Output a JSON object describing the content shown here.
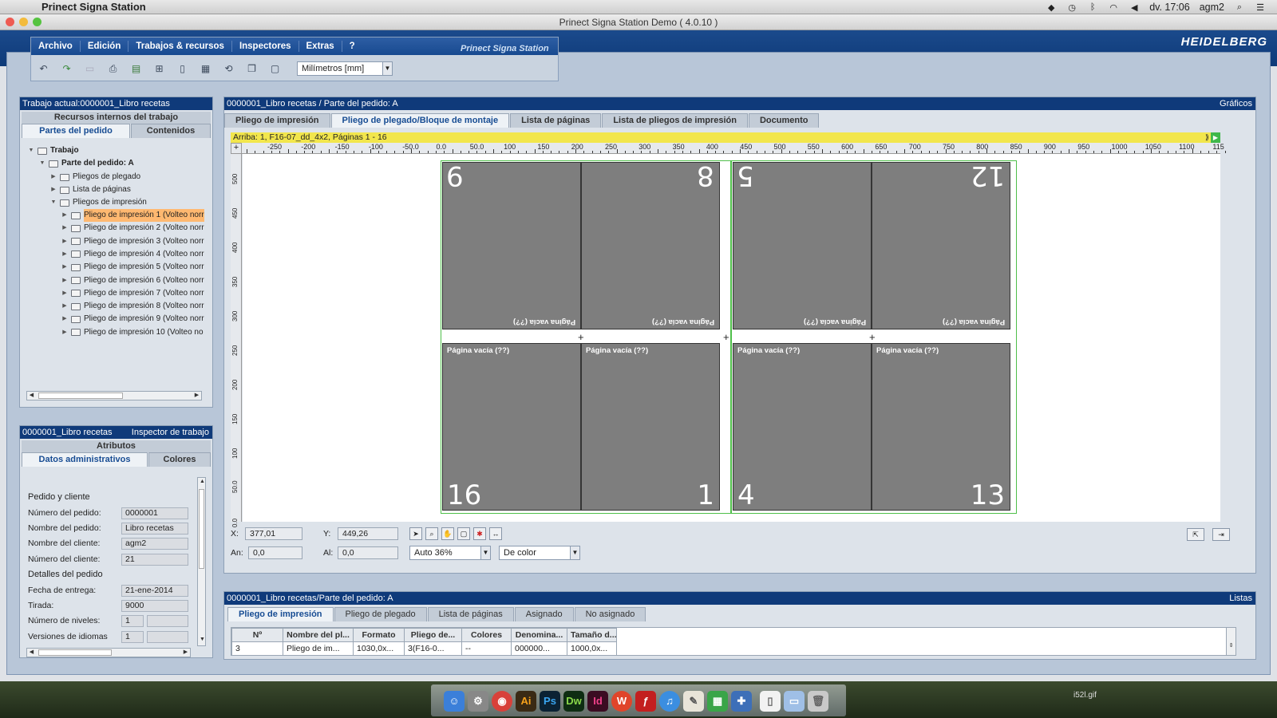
{
  "mac": {
    "app_name": "Prinect Signa Station",
    "day_time": "dv. 17:06",
    "user": "agm2",
    "icons": [
      "dropbox-icon",
      "time-machine-icon",
      "bluetooth-icon",
      "wifi-icon",
      "volume-icon",
      "spotlight-icon",
      "notification-center-icon"
    ]
  },
  "window": {
    "title": "Prinect Signa Station Demo ( 4.0.10 )",
    "brand": "HEIDELBERG",
    "signa_logo": "Prinect Signa Station"
  },
  "menu": {
    "items": [
      "Archivo",
      "Edición",
      "Trabajos & recursos",
      "Inspectores",
      "Extras",
      "?"
    ]
  },
  "toolbar": {
    "icons": [
      "undo-icon",
      "redo-icon",
      "cut-icon",
      "print-icon",
      "job-icon",
      "marks-icon",
      "page-icon",
      "sheet-icon",
      "rotate-icon",
      "copy-icon",
      "paste-icon"
    ],
    "units_value": "Milímetros  [mm]"
  },
  "left": {
    "title": "Trabajo actual:0000001_Libro recetas",
    "resources_header": "Recursos internos del trabajo",
    "tabs": [
      "Partes del pedido",
      "Contenidos"
    ],
    "tree": {
      "root": "Trabajo",
      "part": "Parte del pedido: A",
      "folding": "Pliegos de plegado",
      "pages": "Lista de páginas",
      "press": "Pliegos de impresión",
      "sheets": [
        "Pliego de impresión 1 (Volteo norr",
        "Pliego de impresión 2 (Volteo norr",
        "Pliego de impresión 3 (Volteo norr",
        "Pliego de impresión 4 (Volteo norr",
        "Pliego de impresión 5 (Volteo norr",
        "Pliego de impresión 6 (Volteo norr",
        "Pliego de impresión 7 (Volteo norr",
        "Pliego de impresión 8 (Volteo norr",
        "Pliego de impresión 9 (Volteo norr",
        "Pliego de impresión 10 (Volteo no"
      ]
    }
  },
  "inspector": {
    "title_left": "0000001_Libro recetas",
    "title_right": "Inspector de trabajo",
    "attributes": "Atributos",
    "tabs": [
      "Datos administrativos",
      "Colores"
    ],
    "section1": "Pedido y cliente",
    "section2": "Detalles del pedido",
    "fields": [
      {
        "label": "Número del pedido:",
        "value": "0000001"
      },
      {
        "label": "Nombre del pedido:",
        "value": "Libro recetas"
      },
      {
        "label": "Nombre del cliente:",
        "value": "agm2"
      },
      {
        "label": "Número del cliente:",
        "value": "21"
      },
      {
        "label": "Fecha de entrega:",
        "value": "21-ene-2014"
      },
      {
        "label": "Tirada:",
        "value": "9000"
      },
      {
        "label": "Número de niveles:",
        "value": "1"
      },
      {
        "label": "Versiones de idiomas",
        "value": "1"
      }
    ]
  },
  "center": {
    "title": "0000001_Libro recetas / Parte del pedido: A",
    "title_right": "Gráficos",
    "tabs": [
      "Pliego de impresión",
      "Pliego de plegado/Bloque de montaje",
      "Lista de páginas",
      "Lista de pliegos de impresión",
      "Documento"
    ],
    "active_tab": 1,
    "infobar": "Arriba:  1, F16-07_dd_4x2, Páginas 1 - 16",
    "ruler_top": [
      "-250",
      "-200",
      "-150",
      "-100",
      "-50.0",
      "0.0",
      "50.0",
      "100",
      "150",
      "200",
      "250",
      "300",
      "350",
      "400",
      "450",
      "500",
      "550",
      "600",
      "650",
      "700",
      "750",
      "800",
      "850",
      "900",
      "950",
      "1000",
      "1050",
      "1100",
      "115"
    ],
    "ruler_left": [
      "500",
      "450",
      "400",
      "350",
      "300",
      "250",
      "200",
      "150",
      "100",
      "50.0",
      "0.0"
    ],
    "pages_top": [
      {
        "num": "9",
        "label": "Página vacía (??)"
      },
      {
        "num": "8",
        "label": "Página vacía (??)"
      },
      {
        "num": "5",
        "label": "Página vacía (??)"
      },
      {
        "num": "12",
        "label": "Página vacía (??)"
      }
    ],
    "pages_bottom": [
      {
        "num": "16",
        "label": "Página vacía (??)"
      },
      {
        "num": "1",
        "label": "Página vacía (??)"
      },
      {
        "num": "4",
        "label": "Página vacía (??)"
      },
      {
        "num": "13",
        "label": "Página vacía (??)"
      }
    ],
    "x_label": "X:",
    "x_value": "377,01",
    "y_label": "Y:",
    "y_value": "449,26",
    "w_label": "An:",
    "w_value": "0,0",
    "h_label": "Al:",
    "h_value": "0,0",
    "zoom": "Auto 36%",
    "color_mode": "De color"
  },
  "bottom": {
    "title": "0000001_Libro recetas/Parte del pedido: A",
    "title_right": "Listas",
    "tabs": [
      "Pliego de impresión",
      "Pliego de plegado",
      "Lista de páginas",
      "Asignado",
      "No asignado"
    ],
    "columns": [
      "Nº",
      "Nombre del pl...",
      "Formato",
      "Pliego de...",
      "Colores",
      "Denomina...",
      "Tamaño d..."
    ],
    "rows": [
      [
        "3",
        "Pliego de im...",
        "1030,0x...",
        "3(F16-0...",
        "--",
        "000000...",
        "1000,0x..."
      ]
    ]
  },
  "dock": {
    "label": "i52l.gif"
  }
}
